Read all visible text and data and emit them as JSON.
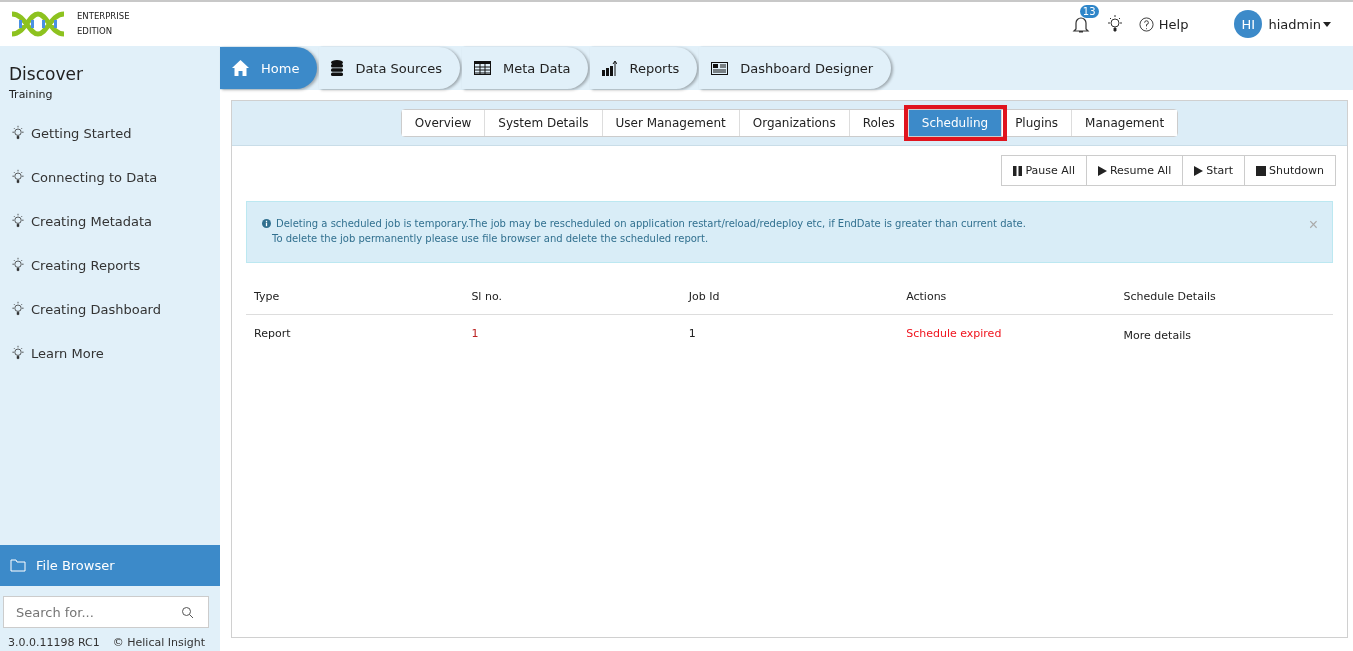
{
  "header": {
    "edition": [
      "ENTERPRISE",
      "EDITION"
    ],
    "notifications": "13",
    "help": "Help",
    "avatar": "HI",
    "user": "hiadmin"
  },
  "sidebar": {
    "title": "Discover",
    "subtitle": "Training",
    "items": [
      {
        "label": "Getting Started"
      },
      {
        "label": "Connecting to Data"
      },
      {
        "label": "Creating Metadata"
      },
      {
        "label": "Creating Reports"
      },
      {
        "label": "Creating Dashboard"
      },
      {
        "label": "Learn More"
      }
    ],
    "file_browser": "File Browser",
    "search": {
      "placeholder": "Search for..."
    },
    "version": "3.0.0.11198 RC1",
    "copyright": "© Helical Insight"
  },
  "nav": [
    {
      "label": "Home",
      "kind": "home",
      "selected": true
    },
    {
      "label": "Data Sources",
      "kind": "database",
      "selected": false
    },
    {
      "label": "Meta Data",
      "kind": "table",
      "selected": false
    },
    {
      "label": "Reports",
      "kind": "chart",
      "selected": false
    },
    {
      "label": "Dashboard Designer",
      "kind": "dashboard",
      "selected": false
    }
  ],
  "tabs": [
    {
      "label": "Overview",
      "selected": false,
      "highlighted": false
    },
    {
      "label": "System Details",
      "selected": false,
      "highlighted": false
    },
    {
      "label": "User Management",
      "selected": false,
      "highlighted": false
    },
    {
      "label": "Organizations",
      "selected": false,
      "highlighted": false
    },
    {
      "label": "Roles",
      "selected": false,
      "highlighted": false
    },
    {
      "label": "Scheduling",
      "selected": true,
      "highlighted": true
    },
    {
      "label": "Plugins",
      "selected": false,
      "highlighted": false
    },
    {
      "label": "Management",
      "selected": false,
      "highlighted": false
    }
  ],
  "actions": [
    {
      "label": "Pause All",
      "kind": "pause"
    },
    {
      "label": "Resume All",
      "kind": "play"
    },
    {
      "label": "Start",
      "kind": "play"
    },
    {
      "label": "Shutdown",
      "kind": "stop"
    }
  ],
  "alert": {
    "lines": [
      "Deleting a scheduled job is temporary.The job may be rescheduled on application restart/reload/redeploy etc, if EndDate is greater than current date.",
      "To delete the job permanently please use file browser and delete the scheduled report."
    ],
    "close": "×"
  },
  "table": {
    "columns": [
      "Type",
      "Sl no.",
      "Job Id",
      "Actions",
      "Schedule Details"
    ],
    "rows": [
      {
        "type": "Report",
        "sl_no": "1",
        "job_id": "1",
        "action": "Schedule expired",
        "expired": true,
        "details": "More details"
      }
    ]
  }
}
